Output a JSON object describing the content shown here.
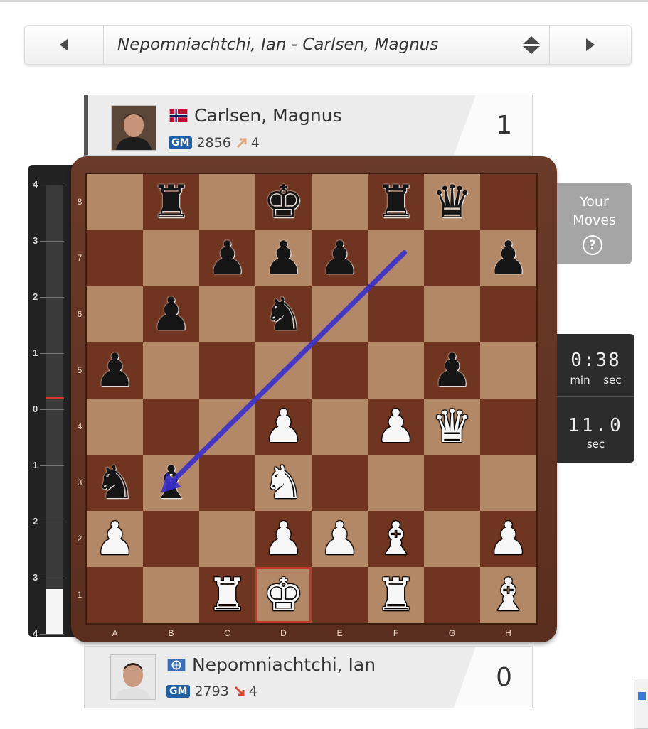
{
  "selector": {
    "title": "Nepomniachtchi, Ian - Carlsen, Magnus"
  },
  "players": {
    "top": {
      "name": "Carlsen, Magnus",
      "title": "GM",
      "rating": "2856",
      "rating_change": "4",
      "score": "1",
      "flag": "norway"
    },
    "bottom": {
      "name": "Nepomniachtchi, Ian",
      "title": "GM",
      "rating": "2793",
      "rating_change": "4",
      "score": "0",
      "flag": "fide"
    }
  },
  "eval_bar": {
    "ticks": [
      "4",
      "3",
      "2",
      "1",
      "0",
      "1",
      "2",
      "3",
      "4"
    ],
    "white_fraction": 0.1
  },
  "board": {
    "files": [
      "A",
      "B",
      "C",
      "D",
      "E",
      "F",
      "G",
      "H"
    ],
    "ranks": [
      "8",
      "7",
      "6",
      "5",
      "4",
      "3",
      "2",
      "1"
    ],
    "pieces": [
      {
        "sq": "b8",
        "p": "r"
      },
      {
        "sq": "d8",
        "p": "k"
      },
      {
        "sq": "f8",
        "p": "r"
      },
      {
        "sq": "g8",
        "p": "q"
      },
      {
        "sq": "c7",
        "p": "p"
      },
      {
        "sq": "d7",
        "p": "p"
      },
      {
        "sq": "e7",
        "p": "p"
      },
      {
        "sq": "h7",
        "p": "p"
      },
      {
        "sq": "b6",
        "p": "p"
      },
      {
        "sq": "d6",
        "p": "n"
      },
      {
        "sq": "a5",
        "p": "p"
      },
      {
        "sq": "g5",
        "p": "p"
      },
      {
        "sq": "d4",
        "p": "P"
      },
      {
        "sq": "f4",
        "p": "P"
      },
      {
        "sq": "g4",
        "p": "Q"
      },
      {
        "sq": "a3",
        "p": "n"
      },
      {
        "sq": "b3",
        "p": "b"
      },
      {
        "sq": "d3",
        "p": "N"
      },
      {
        "sq": "a2",
        "p": "P"
      },
      {
        "sq": "d2",
        "p": "P"
      },
      {
        "sq": "e2",
        "p": "P"
      },
      {
        "sq": "f2",
        "p": "B"
      },
      {
        "sq": "h2",
        "p": "P"
      },
      {
        "sq": "c1",
        "p": "R"
      },
      {
        "sq": "d1",
        "p": "K"
      },
      {
        "sq": "f1",
        "p": "R"
      },
      {
        "sq": "h1",
        "p": "B"
      }
    ],
    "highlight": "d1",
    "arrow": {
      "from": "f7",
      "to": "b3",
      "color": "#3a2fd0"
    }
  },
  "your_moves": {
    "line1": "Your",
    "line2": "Moves",
    "help": "?"
  },
  "timer": {
    "main": "0:38",
    "units": "min sec",
    "secondary": "11.0",
    "secondary_unit": "sec"
  }
}
